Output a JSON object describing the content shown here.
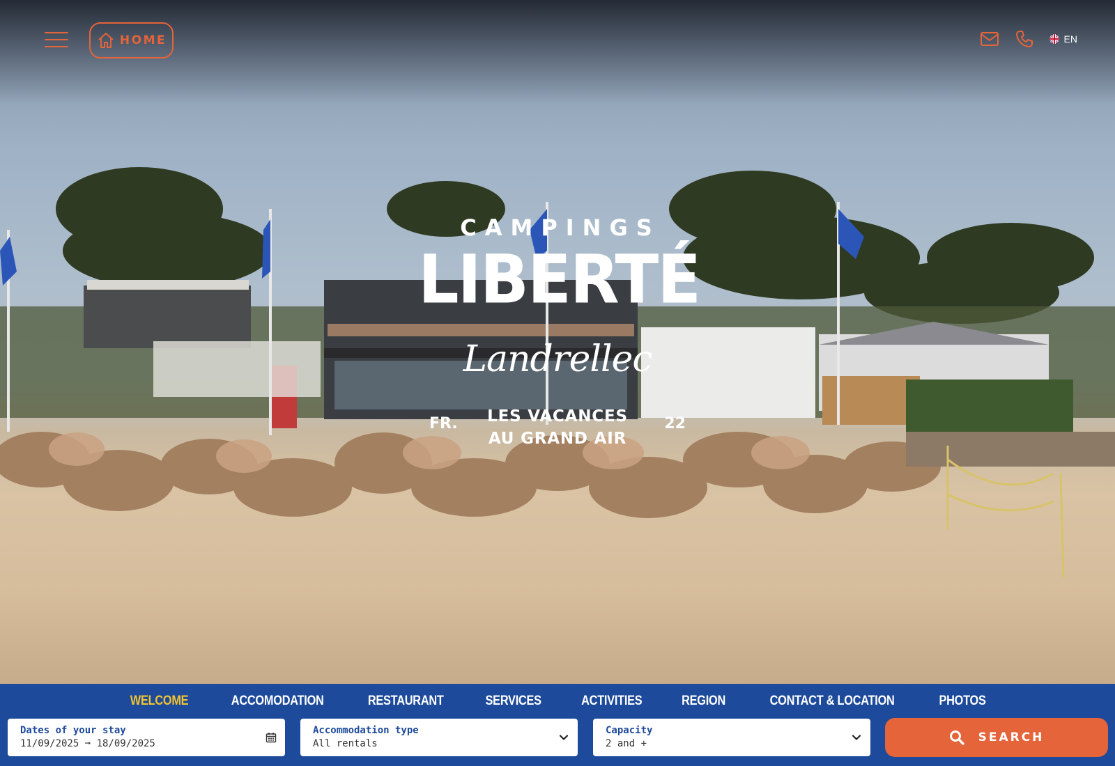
{
  "header": {
    "menu_icon": "hamburger-menu-icon",
    "home_label": "HOME",
    "home_icon": "house-icon",
    "mail_icon": "envelope-icon",
    "phone_icon": "phone-icon",
    "language": "EN",
    "language_flag": "uk-flag-icon",
    "accent_color": "#e5643a"
  },
  "logo": {
    "top_line": "CAMPINGS",
    "main": "LIBERTÉ",
    "script": "Landrellec",
    "left_mark": "FR.",
    "right_mark": "22",
    "tagline_1": "LES VACANCES",
    "tagline_2": "AU GRAND AIR"
  },
  "nav": {
    "background": "#1d4a9a",
    "active_color": "#f2c332",
    "items": [
      {
        "label": "WELCOME",
        "active": true
      },
      {
        "label": "ACCOMODATION",
        "active": false
      },
      {
        "label": "RESTAURANT",
        "active": false
      },
      {
        "label": "SERVICES",
        "active": false
      },
      {
        "label": "ACTIVITIES",
        "active": false
      },
      {
        "label": "REGION",
        "active": false
      },
      {
        "label": "CONTACT & LOCATION",
        "active": false
      },
      {
        "label": "PHOTOS",
        "active": false
      }
    ]
  },
  "booking": {
    "dates": {
      "label": "Dates of your stay",
      "value": "11/09/2025 ➞ 18/09/2025",
      "icon": "calendar-icon"
    },
    "accommodation": {
      "label": "Accommodation type",
      "value": "All rentals",
      "icon": "chevron-down-icon"
    },
    "capacity": {
      "label": "Capacity",
      "value": "2 and +",
      "icon": "chevron-down-icon"
    },
    "search_label": "SEARCH",
    "search_icon": "search-icon"
  }
}
